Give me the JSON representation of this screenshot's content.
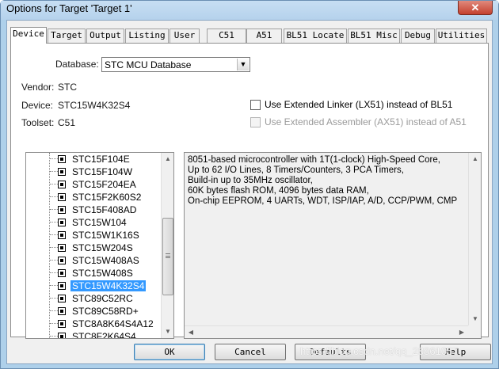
{
  "window": {
    "title": "Options for Target 'Target 1'",
    "close_glyph": "✕"
  },
  "tabs": [
    {
      "label": "Device"
    },
    {
      "label": "Target"
    },
    {
      "label": "Output"
    },
    {
      "label": "Listing"
    },
    {
      "label": "User"
    },
    {
      "label": "C51"
    },
    {
      "label": "A51"
    },
    {
      "label": "BL51 Locate"
    },
    {
      "label": "BL51 Misc"
    },
    {
      "label": "Debug"
    },
    {
      "label": "Utilities"
    }
  ],
  "device": {
    "database_label": "Database:",
    "database_value": "STC MCU Database",
    "vendor_label": "Vendor:",
    "vendor_value": "STC",
    "device_label": "Device:",
    "device_value": "STC15W4K32S4",
    "toolset_label": "Toolset:",
    "toolset_value": "C51",
    "extended_linker": {
      "label": "Use Extended Linker (LX51) instead of BL51",
      "checked": false
    },
    "extended_assembler": {
      "label": "Use Extended Assembler (AX51) instead of A51",
      "checked": false,
      "disabled": true
    }
  },
  "tree": {
    "items": [
      "STC15F104E",
      "STC15F104W",
      "STC15F204EA",
      "STC15F2K60S2",
      "STC15F408AD",
      "STC15W104",
      "STC15W1K16S",
      "STC15W204S",
      "STC15W408AS",
      "STC15W408S",
      "STC15W4K32S4",
      "STC89C52RC",
      "STC89C58RD+",
      "STC8A8K64S4A12",
      "STC8F2K64S4"
    ],
    "selected": "STC15W4K32S4"
  },
  "description": [
    "8051-based microcontroller with 1T(1-clock) High-Speed Core,",
    "Up to 62 I/O Lines, 8 Timers/Counters, 3 PCA Timers,",
    "Build-in up to 35MHz oscillator,",
    "60K bytes flash ROM, 4096 bytes data RAM,",
    "On-chip EEPROM, 4 UARTs, WDT, ISP/IAP, A/D, CCP/PWM, CMP"
  ],
  "buttons": {
    "ok": "OK",
    "cancel": "Cancel",
    "defaults": "Defaults",
    "help": "Help"
  },
  "watermark": "https://blog.csdn.net/qq_28861057"
}
